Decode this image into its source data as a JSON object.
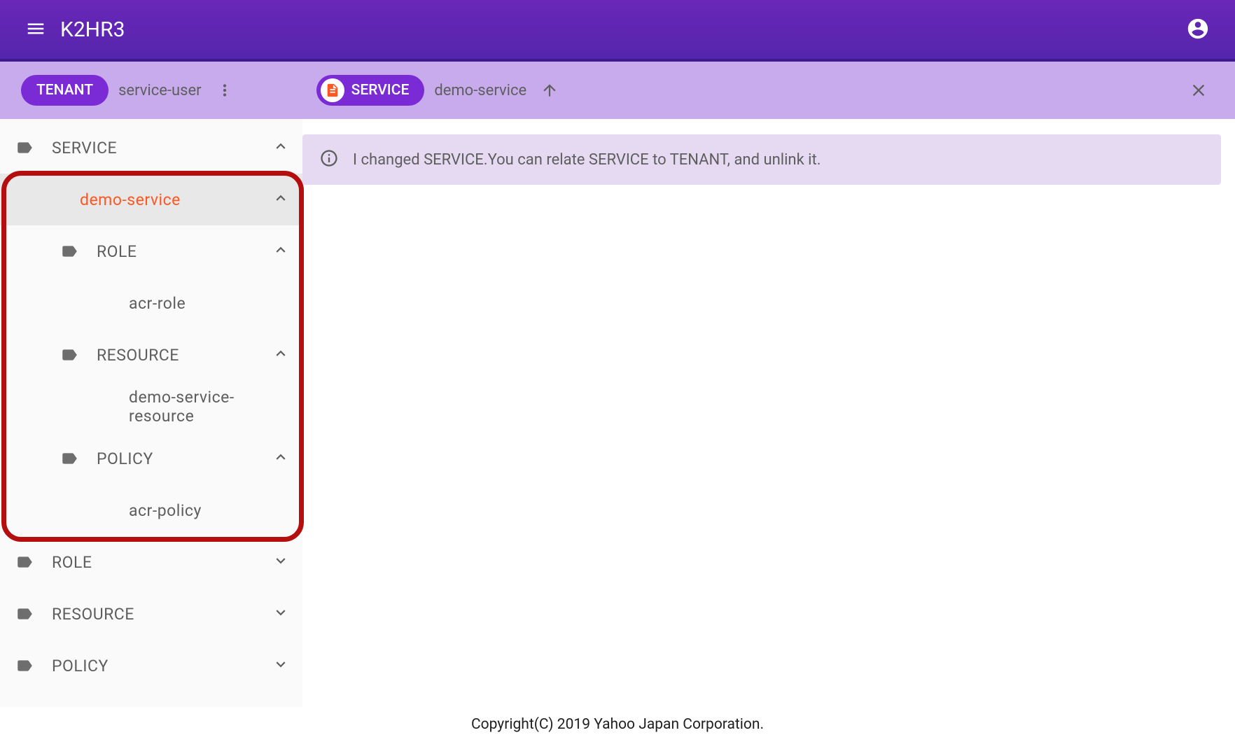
{
  "header": {
    "title": "K2HR3"
  },
  "toolbar": {
    "tenant_chip": "TENANT",
    "tenant_value": "service-user",
    "service_chip": "SERVICE",
    "service_value": "demo-service"
  },
  "sidebar": {
    "items": [
      {
        "label": "SERVICE",
        "level": 1,
        "icon": "label",
        "expand": "up",
        "selected": false
      },
      {
        "label": "demo-service",
        "level": 2,
        "icon": "none",
        "expand": "up",
        "selected": true
      },
      {
        "label": "ROLE",
        "level": 3,
        "icon": "label",
        "expand": "up",
        "selected": false
      },
      {
        "label": "acr-role",
        "level": 4,
        "icon": "none",
        "expand": "none",
        "selected": false
      },
      {
        "label": "RESOURCE",
        "level": 3,
        "icon": "label",
        "expand": "up",
        "selected": false
      },
      {
        "label": "demo-service-resource",
        "level": 4,
        "icon": "none",
        "expand": "none",
        "selected": false
      },
      {
        "label": "POLICY",
        "level": 3,
        "icon": "label",
        "expand": "up",
        "selected": false
      },
      {
        "label": "acr-policy",
        "level": 4,
        "icon": "none",
        "expand": "none",
        "selected": false
      },
      {
        "label": "ROLE",
        "level": 1,
        "icon": "label",
        "expand": "down",
        "selected": false
      },
      {
        "label": "RESOURCE",
        "level": 1,
        "icon": "label",
        "expand": "down",
        "selected": false
      },
      {
        "label": "POLICY",
        "level": 1,
        "icon": "label",
        "expand": "down",
        "selected": false
      }
    ]
  },
  "info": {
    "text": "I changed SERVICE.You can relate SERVICE to TENANT, and unlink it."
  },
  "footer": {
    "text": "Copyright(C) 2019 Yahoo Japan Corporation."
  }
}
